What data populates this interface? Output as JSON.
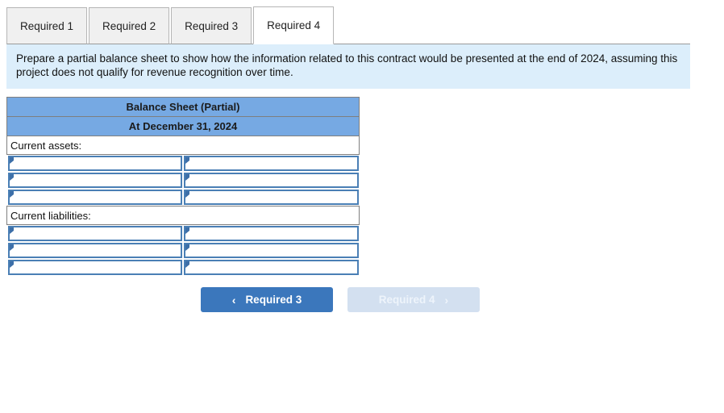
{
  "tabs": [
    {
      "label": "Required 1",
      "active": false
    },
    {
      "label": "Required 2",
      "active": false
    },
    {
      "label": "Required 3",
      "active": false
    },
    {
      "label": "Required 4",
      "active": true
    }
  ],
  "instruction": {
    "text": "Prepare a partial balance sheet to show how the information related to this contract would be presented at the end of 2024, assuming this project does not qualify for revenue recognition over time."
  },
  "balance_sheet": {
    "title": "Balance Sheet (Partial)",
    "subtitle": "At December 31, 2024",
    "sections": [
      {
        "label": "Current assets:",
        "rows": [
          {
            "description": "",
            "amount": ""
          },
          {
            "description": "",
            "amount": ""
          },
          {
            "description": "",
            "amount": ""
          }
        ]
      },
      {
        "label": "Current liabilities:",
        "rows": [
          {
            "description": "",
            "amount": ""
          },
          {
            "description": "",
            "amount": ""
          },
          {
            "description": "",
            "amount": ""
          }
        ]
      }
    ]
  },
  "navigation": {
    "prev": {
      "label": "Required 3",
      "icon": "chevron-left-icon",
      "glyph": "‹",
      "enabled": true
    },
    "next": {
      "label": "Required 4",
      "icon": "chevron-right-icon",
      "glyph": "›",
      "enabled": false
    }
  },
  "colors": {
    "header_blue": "#76a9e3",
    "banner_blue": "#dceefb",
    "button_active": "#3b77bc",
    "button_disabled": "#d3e0f0",
    "field_border": "#4a7fb5"
  }
}
